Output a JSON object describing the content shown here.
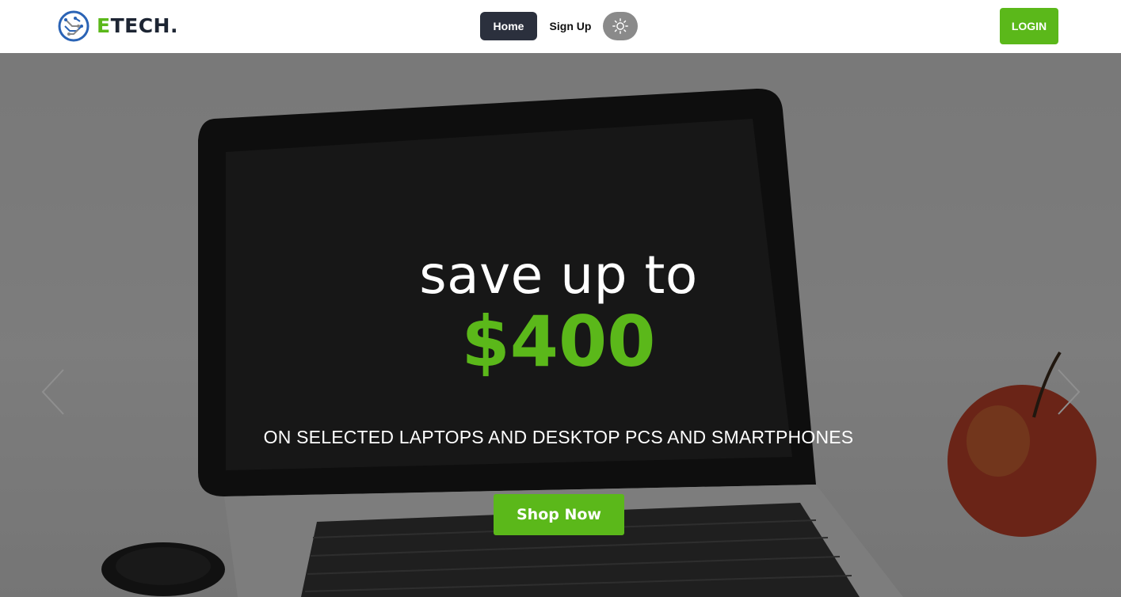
{
  "brand": {
    "first_letter": "E",
    "rest": "TECH.",
    "logo_icon": "circuit-globe-logo"
  },
  "nav": {
    "home_label": "Home",
    "signup_label": "Sign Up",
    "theme_icon": "sun-icon",
    "login_label": "LOGIN"
  },
  "hero": {
    "title": "save up to",
    "amount": "$400",
    "subtitle": "ON SELECTED LAPTOPS AND DESKTOP PCS AND SMARTPHONES",
    "cta_label": "Shop Now",
    "prev_icon": "chevron-left-icon",
    "next_icon": "chevron-right-icon"
  },
  "colors": {
    "accent": "#5bb81a",
    "nav_active_bg": "#2b303d",
    "toggle_bg": "#8a8a8a",
    "text_dark": "#1d2533"
  }
}
